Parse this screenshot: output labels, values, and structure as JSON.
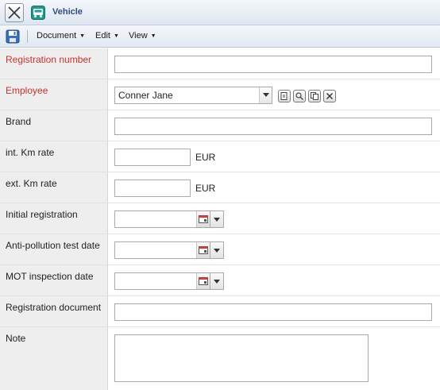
{
  "window": {
    "title": "Vehicle",
    "close_icon": "close-icon",
    "app_icon": "vehicle-icon"
  },
  "toolbar": {
    "save_icon": "save-icon",
    "menus": [
      {
        "label": "Document"
      },
      {
        "label": "Edit"
      },
      {
        "label": "View"
      }
    ]
  },
  "form": {
    "registration_number": {
      "label": "Registration number",
      "value": "",
      "required": true
    },
    "employee": {
      "label": "Employee",
      "value": "Conner Jane",
      "required": true,
      "actions": [
        "new-document-icon",
        "search-icon",
        "copy-icon",
        "clear-icon"
      ]
    },
    "brand": {
      "label": "Brand",
      "value": ""
    },
    "int_km_rate": {
      "label": "int. Km rate",
      "value": "",
      "unit": "EUR"
    },
    "ext_km_rate": {
      "label": "ext. Km rate",
      "value": "",
      "unit": "EUR"
    },
    "initial_registration": {
      "label": "Initial registration",
      "value": ""
    },
    "anti_pollution_test_date": {
      "label": "Anti-pollution test date",
      "value": ""
    },
    "mot_inspection_date": {
      "label": "MOT inspection date",
      "value": ""
    },
    "registration_document": {
      "label": "Registration document",
      "value": ""
    },
    "note": {
      "label": "Note",
      "value": ""
    }
  },
  "colors": {
    "required_label": "#c8322c",
    "title_text": "#2e4e7e",
    "label_background": "#eeeeee"
  }
}
